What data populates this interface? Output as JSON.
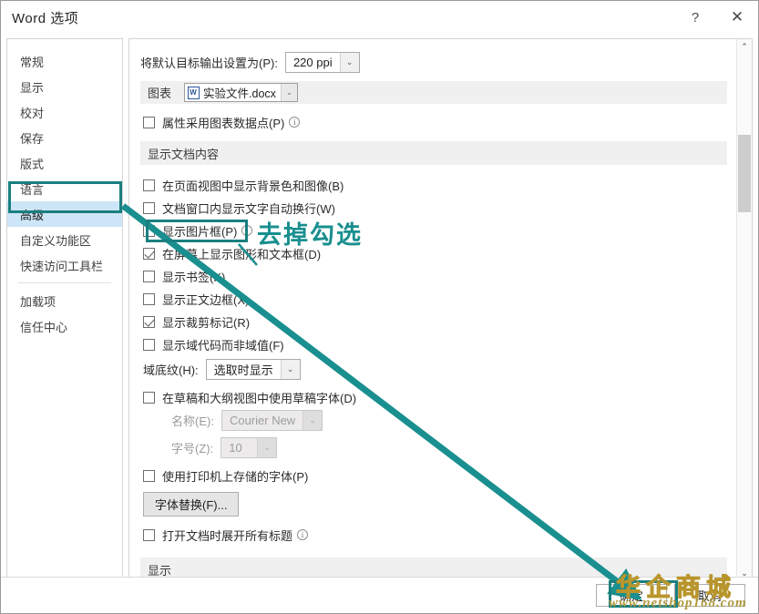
{
  "window": {
    "title": "Word 选项",
    "help_label": "?",
    "close_label": "✕"
  },
  "sidebar": {
    "items": [
      {
        "label": "常规",
        "selected": false
      },
      {
        "label": "显示",
        "selected": false
      },
      {
        "label": "校对",
        "selected": false
      },
      {
        "label": "保存",
        "selected": false
      },
      {
        "label": "版式",
        "selected": false
      },
      {
        "label": "语言",
        "selected": false
      },
      {
        "label": "高级",
        "selected": true
      },
      {
        "label": "自定义功能区",
        "selected": false
      },
      {
        "label": "快速访问工具栏",
        "selected": false
      },
      {
        "label": "加载项",
        "selected": false
      },
      {
        "label": "信任中心",
        "selected": false
      }
    ]
  },
  "main": {
    "default_output": {
      "label": "将默认目标输出设置为(P):",
      "value": "220 ppi"
    },
    "chart_band": {
      "label": "图表",
      "doc_name": "实验文件.docx",
      "doc_icon": "word-document-icon"
    },
    "chart_checkbox": {
      "label": "属性采用图表数据点(P)",
      "checked": false,
      "has_info": true
    },
    "section_display_content": "显示文档内容",
    "checkboxes": [
      {
        "label": "在页面视图中显示背景色和图像(B)",
        "checked": false,
        "info": false
      },
      {
        "label": "文档窗口内显示文字自动换行(W)",
        "checked": false,
        "info": false
      },
      {
        "label": "显示图片框(P)",
        "checked": false,
        "info": true
      },
      {
        "label": "在屏幕上显示图形和文本框(D)",
        "checked": true,
        "info": false
      },
      {
        "label": "显示书签(K)",
        "checked": false,
        "info": false
      },
      {
        "label": "显示正文边框(X)",
        "checked": false,
        "info": false
      },
      {
        "label": "显示裁剪标记(R)",
        "checked": true,
        "info": false
      },
      {
        "label": "显示域代码而非域值(F)",
        "checked": false,
        "info": false
      }
    ],
    "field_shading": {
      "label": "域底纹(H):",
      "value": "选取时显示"
    },
    "draft_font_checkbox": {
      "label": "在草稿和大纲视图中使用草稿字体(D)",
      "checked": false
    },
    "font_name": {
      "label": "名称(E):",
      "value": "Courier New"
    },
    "font_size": {
      "label": "字号(Z):",
      "value": "10"
    },
    "printer_font_checkbox": {
      "label": "使用打印机上存储的字体(P)",
      "checked": false
    },
    "font_substitution_button": "字体替换(F)...",
    "expand_headings_checkbox": {
      "label": "打开文档时展开所有标题",
      "checked": false,
      "info": true
    },
    "section_display": "显示"
  },
  "footer": {
    "ok_label": "确定",
    "cancel_label": "取消"
  },
  "annotation": {
    "text": "去掉勾选",
    "color": "#1a8f8f",
    "box_color": "#1a7f7f"
  },
  "watermark": {
    "brand": "华企商城",
    "url": "www.netshop168.com",
    "brand_color": "#e8c44a",
    "url_color": "#b0993e"
  },
  "scrollbar": {
    "up_arrow": "⌃",
    "down_arrow": "⌄"
  },
  "icons": {
    "combo_arrow": "⌄"
  }
}
